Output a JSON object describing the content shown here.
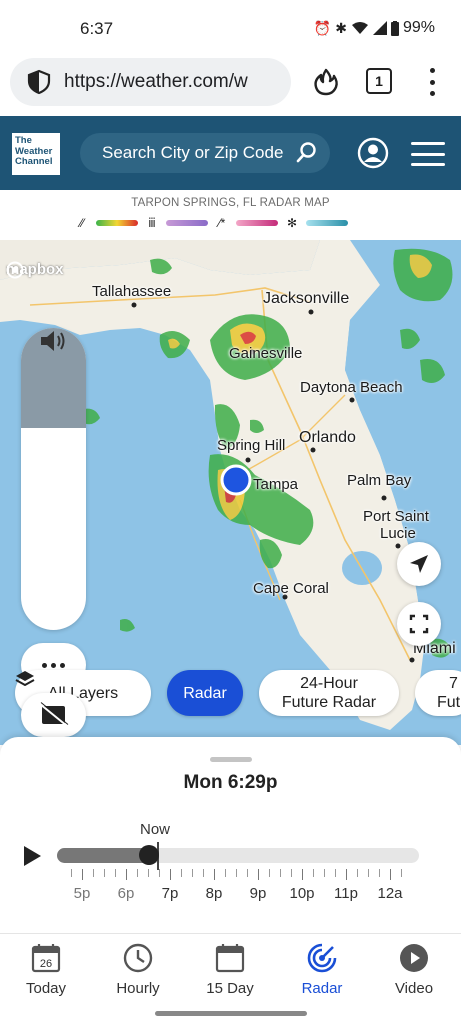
{
  "status_bar": {
    "time": "6:37",
    "battery": "99%"
  },
  "browser": {
    "url": "https://weather.com/w",
    "tab_count": "1"
  },
  "header": {
    "logo_text": [
      "The",
      "Weather",
      "Channel"
    ],
    "search_placeholder": "Search City or Zip Code"
  },
  "legend": {
    "title": "TARPON SPRINGS, FL RADAR MAP",
    "keys": [
      {
        "icon": "rain-icon",
        "colors": [
          "#3bb34a",
          "#f2d633",
          "#d92a2a"
        ]
      },
      {
        "icon": "ice-icon",
        "colors": [
          "#c79ad6",
          "#8a6bc8"
        ]
      },
      {
        "icon": "mix-icon",
        "colors": [
          "#f3a6c7",
          "#c42b7a"
        ]
      },
      {
        "icon": "snow-icon",
        "colors": [
          "#a6e1ee",
          "#2a8fa8"
        ]
      }
    ]
  },
  "map": {
    "attribution": "mapbox",
    "cities": {
      "tallahassee": "Tallahassee",
      "jacksonville": "Jacksonville",
      "gainesville": "Gainesville",
      "daytona": "Daytona Beach",
      "spring_hill": "Spring Hill",
      "orlando": "Orlando",
      "tampa": "Tampa",
      "palm_bay": "Palm Bay",
      "port_saint_lucie_1": "Port Saint",
      "port_saint_lucie_2": "Lucie",
      "cape_coral": "Cape Coral",
      "miami": "Miami"
    },
    "opacity_level": 0.33,
    "chips": {
      "all_layers": "All Layers",
      "radar": "Radar",
      "future_radar_1": "24-Hour",
      "future_radar_2": "Future Radar",
      "partial_1": "7",
      "partial_2": "Fut"
    }
  },
  "timeline": {
    "current_time": "Mon 6:29p",
    "now_label": "Now",
    "progress": 0.255,
    "hours": [
      "5p",
      "6p",
      "7p",
      "8p",
      "9p",
      "10p",
      "11p",
      "12a"
    ]
  },
  "nav": {
    "items": [
      {
        "label": "Today",
        "day": "26"
      },
      {
        "label": "Hourly"
      },
      {
        "label": "15 Day"
      },
      {
        "label": "Radar"
      },
      {
        "label": "Video"
      }
    ],
    "active": "Radar"
  },
  "colors": {
    "header_bg": "#1e5475",
    "accent_blue": "#1a4fd6",
    "location_dot": "#1e55e0"
  }
}
